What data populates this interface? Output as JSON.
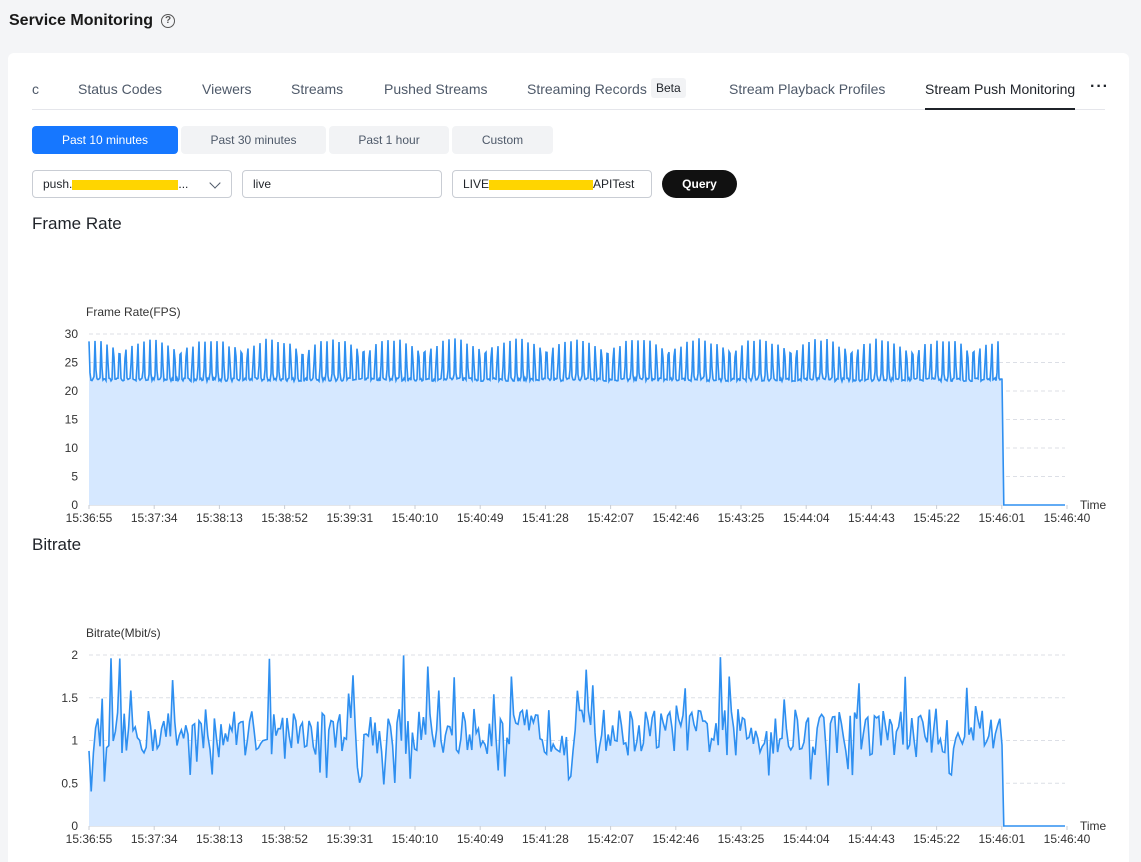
{
  "header": {
    "title": "Service Monitoring",
    "help_glyph": "?"
  },
  "tabs": [
    {
      "label": "c"
    },
    {
      "label": "Status Codes"
    },
    {
      "label": "Viewers"
    },
    {
      "label": "Streams"
    },
    {
      "label": "Pushed Streams"
    },
    {
      "label": "Streaming Records"
    },
    {
      "label": "Stream Playback Profiles"
    },
    {
      "label": "Stream Push Monitoring"
    }
  ],
  "active_tab": "Stream Push Monitoring",
  "beta_badge": "Beta",
  "more_glyph": "···",
  "time_range": {
    "options": [
      "Past 10 minutes",
      "Past 30 minutes",
      "Past 1 hour",
      "Custom"
    ],
    "selected": "Past 10 minutes"
  },
  "filters": {
    "domain_prefix": "push.",
    "domain_suffix": "...",
    "app_value": "live",
    "stream_prefix": "LIVE",
    "stream_suffix": "APITest",
    "query_label": "Query"
  },
  "colors": {
    "accent": "#1677ff",
    "line": "#2e8ff0",
    "fill": "#d6e8ff",
    "redaction": "#ffd500"
  },
  "frame_rate_section": {
    "title": "Frame Rate"
  },
  "bitrate_section": {
    "title": "Bitrate"
  },
  "chart_data": [
    {
      "type": "area",
      "ylabel": "Frame Rate(FPS)",
      "xlabel": "Time",
      "ylim": [
        0,
        30
      ],
      "yticks": [
        0,
        5,
        10,
        15,
        20,
        25,
        30
      ],
      "x_tick_labels": [
        "15:36:55",
        "15:37:34",
        "15:38:13",
        "15:38:52",
        "15:39:31",
        "15:40:10",
        "15:40:49",
        "15:41:28",
        "15:42:07",
        "15:42:46",
        "15:43:25",
        "15:44:04",
        "15:44:43",
        "15:45:22",
        "15:46:01",
        "15:46:40"
      ],
      "grid": true,
      "series": [
        {
          "summary": "oscillates between ~22 and ~29 FPS from 15:36:55 until ~15:46:01, then drops to 0",
          "min": 22,
          "max": 29,
          "drop_time": "15:46:01",
          "after_drop": 0
        }
      ]
    },
    {
      "type": "area",
      "ylabel": "Bitrate(Mbit/s)",
      "xlabel": "Time",
      "ylim": [
        0,
        2
      ],
      "yticks": [
        "0",
        "0.5",
        "1",
        "1.5",
        "2"
      ],
      "x_tick_labels": [
        "15:36:55",
        "15:37:34",
        "15:38:13",
        "15:38:52",
        "15:39:31",
        "15:40:10",
        "15:40:49",
        "15:41:28",
        "15:42:07",
        "15:42:46",
        "15:43:25",
        "15:44:04",
        "15:44:43",
        "15:45:22",
        "15:46:01",
        "15:46:40"
      ],
      "grid": true,
      "series": [
        {
          "summary": "fluctuates around ~1.1 Mbit/s (range ~0.4–2.0) until ~15:46:01, then drops to 0",
          "mean": 1.1,
          "min": 0.4,
          "max": 2.0,
          "drop_time": "15:46:01",
          "after_drop": 0
        }
      ]
    }
  ]
}
